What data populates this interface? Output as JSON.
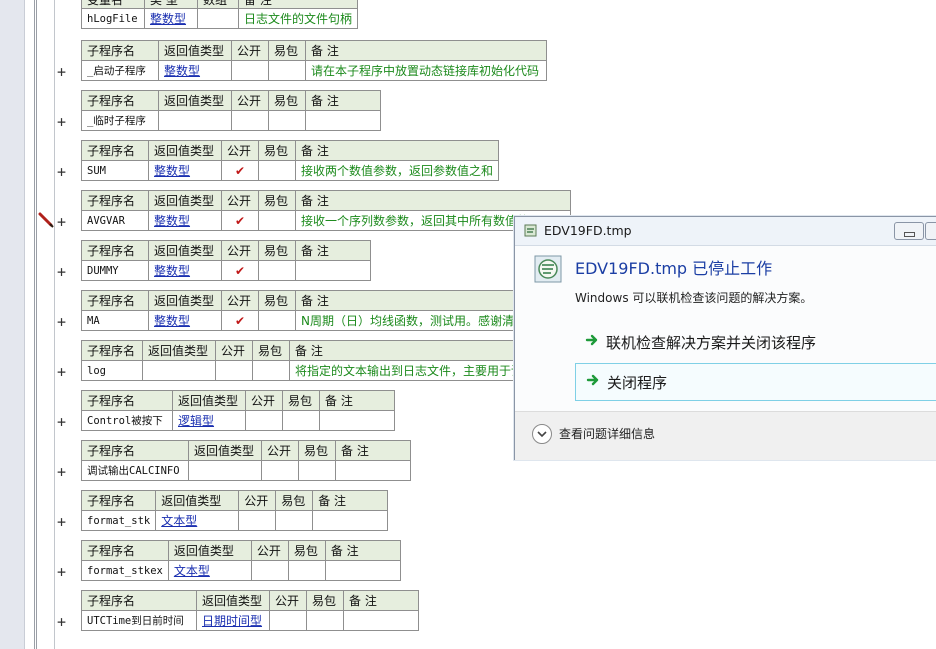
{
  "header_cols": {
    "name": "子程序名",
    "ret": "返回值类型",
    "pub": "公开",
    "pack": "易包",
    "note": "备 注"
  },
  "var_table": {
    "cols": [
      "变量名",
      "类 型",
      "数组",
      "备 注"
    ],
    "row": {
      "name": "hLogFile",
      "type": "整数型",
      "arr": "",
      "note": "日志文件的文件句柄"
    }
  },
  "subs": [
    {
      "name": "_启动子程序",
      "ret": "整数型",
      "pub": false,
      "note": "请在本子程序中放置动态链接库初始化代码"
    },
    {
      "name": "_临时子程序",
      "ret": "",
      "pub": false,
      "note": ""
    },
    {
      "name": "SUM",
      "ret": "整数型",
      "pub": true,
      "note": "接收两个数值参数，返回参数值之和"
    },
    {
      "name": "AVGVAR",
      "ret": "整数型",
      "pub": true,
      "note": "接收一个序列数参数，返回其中所有数值的"
    },
    {
      "name": "DUMMY",
      "ret": "整数型",
      "pub": true,
      "note": ""
    },
    {
      "name": "MA",
      "ret": "整数型",
      "pub": true,
      "note": "N周期（日）均线函数，测试用。感谢清风"
    },
    {
      "name": "log",
      "ret": "",
      "pub": false,
      "note": "将指定的文本输出到日志文件，主要用于调"
    },
    {
      "name": "Control被按下",
      "ret": "逻辑型",
      "pub": false,
      "note": ""
    },
    {
      "name": "调试输出CALCINFO",
      "ret": "",
      "pub": false,
      "note": ""
    },
    {
      "name": "format_stk",
      "ret": "文本型",
      "pub": false,
      "note": ""
    },
    {
      "name": "format_stkex",
      "ret": "文本型",
      "pub": false,
      "note": ""
    },
    {
      "name": "UTCTime到日前时间",
      "ret": "日期时间型",
      "pub": false,
      "note": ""
    }
  ],
  "dialog": {
    "title": "EDV19FD.tmp",
    "heading": "EDV19FD.tmp 已停止工作",
    "desc": "Windows 可以联机检查该问题的解决方案。",
    "option1": "联机检查解决方案并关闭该程序",
    "option2": "关闭程序",
    "details": "查看问题详细信息"
  },
  "colors": {
    "type_link": "#1a2fb0",
    "note_green": "#1c8a1c",
    "check_red": "#c01818",
    "header_bg": "#e6eede"
  },
  "icons": {
    "plus": "+",
    "check": "✔"
  }
}
